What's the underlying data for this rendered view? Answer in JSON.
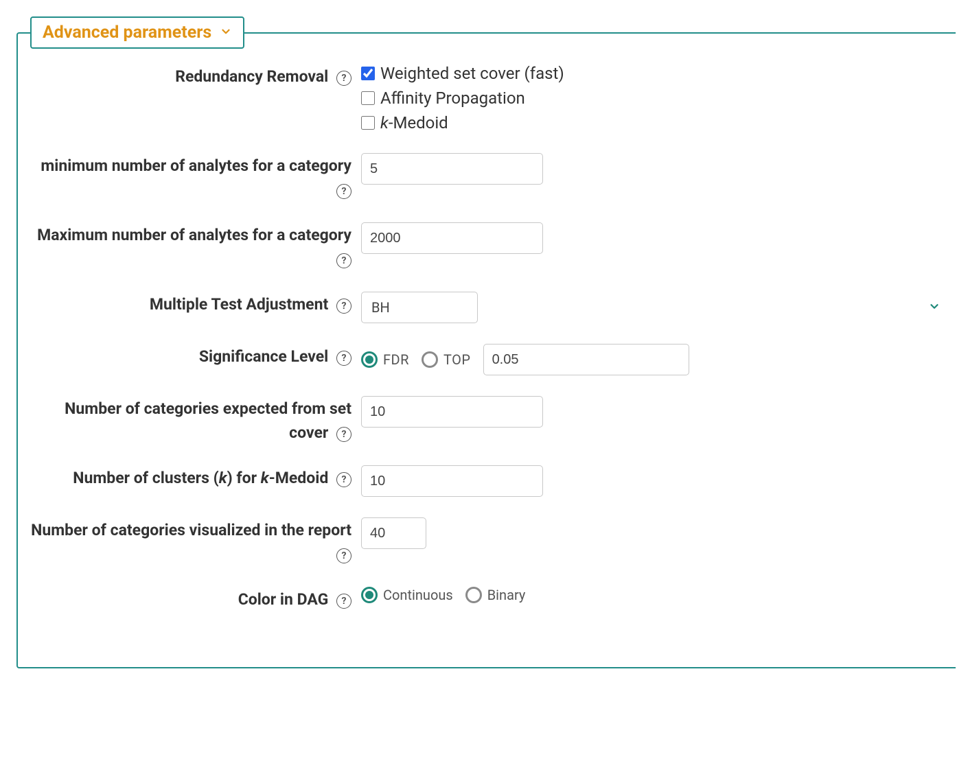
{
  "panel": {
    "title": "Advanced parameters"
  },
  "fields": {
    "redundancy": {
      "label": "Redundancy Removal",
      "options": {
        "weighted": {
          "label": "Weighted set cover (fast)",
          "checked": true
        },
        "affinity": {
          "label": "Affinity Propagation",
          "checked": false
        },
        "kmedoid": {
          "label_prefix_italic": "k",
          "label_suffix": "-Medoid",
          "checked": false
        }
      }
    },
    "min_analytes": {
      "label": "minimum number of analytes for a category",
      "value": "5"
    },
    "max_analytes": {
      "label": "Maximum number of analytes for a category",
      "value": "2000"
    },
    "mtest": {
      "label": "Multiple Test Adjustment",
      "value": "BH"
    },
    "sig": {
      "label": "Significance Level",
      "value": "0.05",
      "options": {
        "fdr": {
          "label": "FDR",
          "selected": true
        },
        "top": {
          "label": "TOP",
          "selected": false
        }
      }
    },
    "setcover_n": {
      "label": "Number of categories expected from set cover",
      "value": "10"
    },
    "kmed_k": {
      "label_pre": "Number of clusters (",
      "label_k1": "k",
      "label_mid": ") for ",
      "label_k2": "k",
      "label_post": "-Medoid",
      "value": "10"
    },
    "viz_n": {
      "label": "Number of categories visualized in the report",
      "value": "40"
    },
    "dag": {
      "label": "Color in DAG",
      "options": {
        "continuous": {
          "label": "Continuous",
          "selected": true
        },
        "binary": {
          "label": "Binary",
          "selected": false
        }
      }
    }
  }
}
